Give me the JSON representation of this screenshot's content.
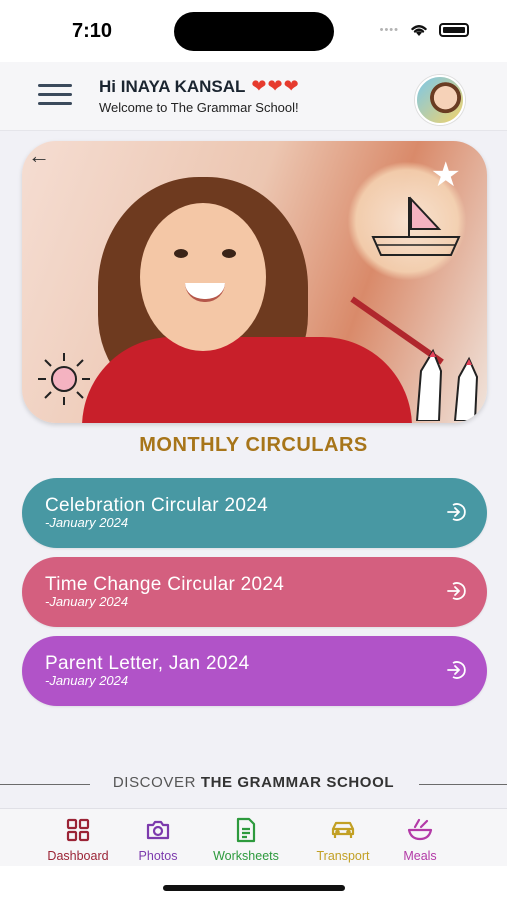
{
  "status_bar": {
    "time": "7:10"
  },
  "header": {
    "greeting": "Hi INAYA KANSAL",
    "hearts": "❤❤❤",
    "welcome": "Welcome to The Grammar School!"
  },
  "section_title": "MONTHLY CIRCULARS",
  "circulars": [
    {
      "title": "Celebration Circular 2024",
      "date": "-January 2024",
      "color": "#4898a3"
    },
    {
      "title": "Time Change Circular 2024",
      "date": "-January 2024",
      "color": "#d45f7f"
    },
    {
      "title": "Parent Letter, Jan 2024",
      "date": "-January 2024",
      "color": "#b153c8"
    }
  ],
  "discover": {
    "prefix": "DISCOVER",
    "name": "THE GRAMMAR SCHOOL"
  },
  "tabs": [
    {
      "label": "Dashboard",
      "icon": "grid-icon",
      "color": "#9b2436"
    },
    {
      "label": "Photos",
      "icon": "camera-icon",
      "color": "#7c3aad"
    },
    {
      "label": "Worksheets",
      "icon": "document-icon",
      "color": "#2d9a3d"
    },
    {
      "label": "Transport",
      "icon": "car-icon",
      "color": "#c2a025"
    },
    {
      "label": "Meals",
      "icon": "bowl-icon",
      "color": "#b33aa7"
    }
  ]
}
